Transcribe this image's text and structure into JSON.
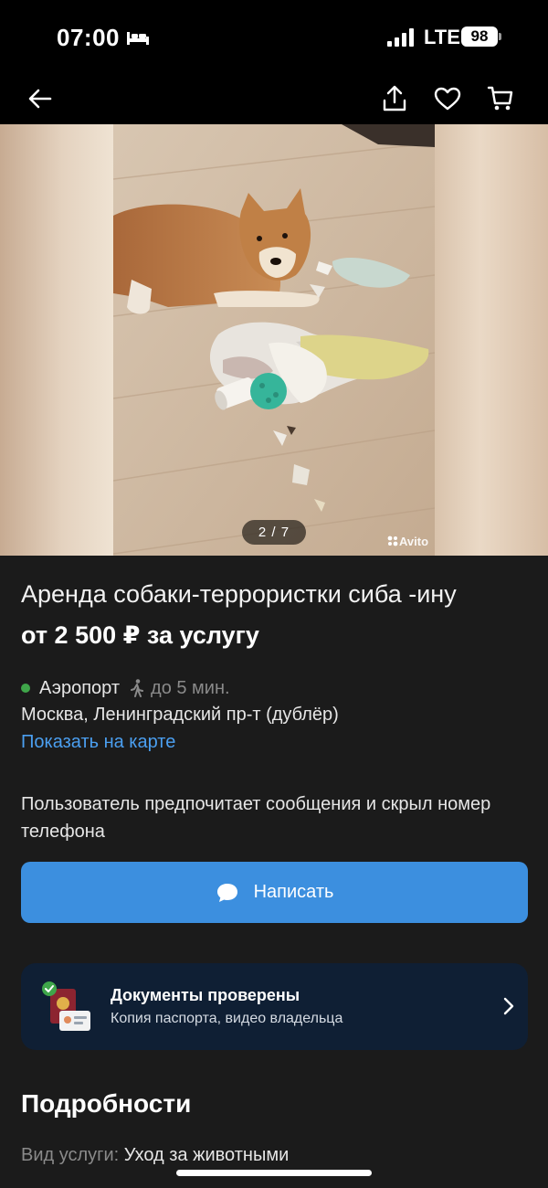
{
  "status_bar": {
    "time": "07:00",
    "network": "LTE",
    "battery": "98",
    "icons": [
      "bed-icon",
      "signal-icon"
    ]
  },
  "nav": {
    "icons": [
      "back-arrow-icon",
      "share-icon",
      "heart-icon",
      "cart-icon"
    ]
  },
  "gallery": {
    "page_indicator": "2 / 7",
    "watermark": "Avito"
  },
  "listing": {
    "title": "Аренда собаки-террористки сиба -ину",
    "price": "от 2 500 ₽ за услугу"
  },
  "location": {
    "metro": "Аэропорт",
    "metro_color": "#3fa64a",
    "walk_time": "до 5 мин.",
    "address": "Москва, Ленинградский пр-т (дублёр)",
    "map_link": "Показать на карте"
  },
  "contact": {
    "note": "Пользователь предпочитает сообщения и скрыл номер телефона",
    "write_button": "Написать",
    "accent_color": "#3c8fdf"
  },
  "docs": {
    "title": "Документы проверены",
    "subtitle": "Копия паспорта, видео владельца"
  },
  "details": {
    "section_title": "Подробности",
    "rows": [
      {
        "label": "Вид услуги:",
        "value": "Уход за животными"
      }
    ]
  }
}
